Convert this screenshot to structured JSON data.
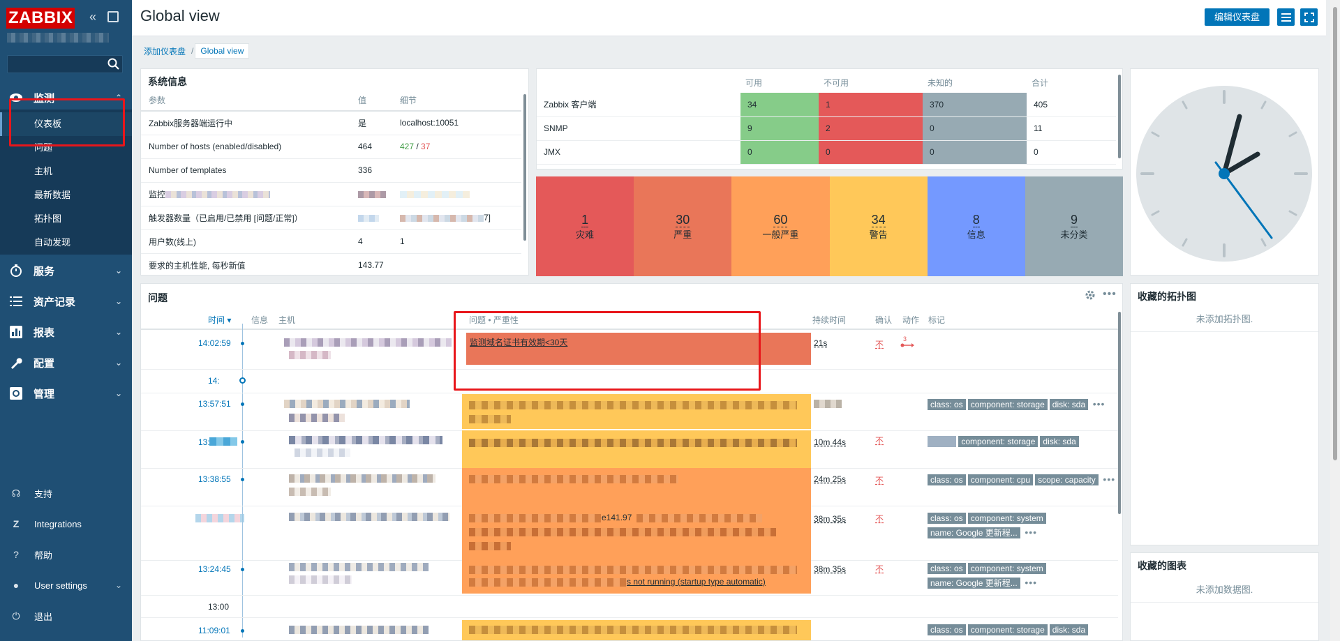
{
  "brand": {
    "logo": "ZABBIX"
  },
  "sidebar": {
    "monitoring": "监测",
    "sub_items": [
      "仪表板",
      "问题",
      "主机",
      "最新数据",
      "拓扑图",
      "自动发现"
    ],
    "sections": [
      "服务",
      "资产记录",
      "报表",
      "配置",
      "管理"
    ],
    "bottom": [
      "支持",
      "Integrations",
      "帮助",
      "User settings",
      "退出"
    ]
  },
  "header": {
    "title": "Global view",
    "edit_button": "编辑仪表盘"
  },
  "breadcrumb": [
    "添加仪表盘",
    "Global view"
  ],
  "system_info": {
    "title": "系统信息",
    "columns": [
      "参数",
      "值",
      "细节"
    ],
    "rows": [
      {
        "param": "Zabbix服务器端运行中",
        "value": "是",
        "detail": "localhost:10051"
      },
      {
        "param": "Number of hosts (enabled/disabled)",
        "value": "464",
        "detail_enabled": "427",
        "detail_sep": " / ",
        "detail_disabled": "37"
      },
      {
        "param": "Number of templates",
        "value": "336",
        "detail": ""
      },
      {
        "param": "监控",
        "value": "",
        "detail": ""
      },
      {
        "param": "触发器数量（已启用/已禁用 [问题/正常]）",
        "value": "",
        "detail": "7]"
      },
      {
        "param": "用户数(线上)",
        "value": "4",
        "detail": "1"
      },
      {
        "param": "要求的主机性能, 每秒新值",
        "value": "143.77",
        "detail": ""
      }
    ]
  },
  "host_availability": {
    "columns": [
      "可用",
      "不可用",
      "未知的",
      "合计"
    ],
    "rows": [
      {
        "name": "Zabbix 客户端",
        "available": "34",
        "unavailable": "1",
        "unknown": "370",
        "total": "405"
      },
      {
        "name": "SNMP",
        "available": "9",
        "unavailable": "2",
        "unknown": "0",
        "total": "11"
      },
      {
        "name": "JMX",
        "available": "0",
        "unavailable": "0",
        "unknown": "0",
        "total": "0"
      }
    ]
  },
  "severity": [
    {
      "count": "1",
      "label": "灾难",
      "color": "#e45959"
    },
    {
      "count": "30",
      "label": "严重",
      "color": "#e97659"
    },
    {
      "count": "60",
      "label": "一般严重",
      "color": "#ffa059"
    },
    {
      "count": "34",
      "label": "警告",
      "color": "#ffc859"
    },
    {
      "count": "8",
      "label": "信息",
      "color": "#7499ff"
    },
    {
      "count": "9",
      "label": "未分类",
      "color": "#97aab3"
    }
  ],
  "problems": {
    "title": "问题",
    "columns": [
      "时间",
      "信息",
      "主机",
      "问题 • 严重性",
      "持续时间",
      "确认",
      "动作",
      "标记"
    ],
    "rows": [
      {
        "time": "14:02:59",
        "problem": "监测域名证书有效期<30天",
        "duration": "21s",
        "ack": "不",
        "action": "3"
      },
      {
        "time": "14:",
        "problem": "",
        "duration": "",
        "ack": ""
      },
      {
        "time": "13:57:51",
        "problem": "",
        "duration": "",
        "ack": "",
        "tags": [
          "class: os",
          "component: storage",
          "disk: sda"
        ]
      },
      {
        "time": "13:",
        "problem": "",
        "duration": "10m 44s",
        "ack": "不",
        "tags": [
          "component: storage",
          "disk: sda"
        ]
      },
      {
        "time": "13:38:55",
        "problem": "",
        "duration": "24m 25s",
        "ack": "不",
        "tags": [
          "class: os",
          "component: cpu",
          "scope: capacity"
        ]
      },
      {
        "time": "",
        "problem": "e141.97",
        "duration": "38m 35s",
        "ack": "不",
        "tags": [
          "class: os",
          "component: system",
          "name: Google 更新程..."
        ]
      },
      {
        "time": "13:24:45",
        "problem": "s not running (startup type automatic)",
        "duration": "38m 35s",
        "ack": "不",
        "tags": [
          "class: os",
          "component: system",
          "name: Google 更新程..."
        ]
      },
      {
        "time": "13:00",
        "problem": "",
        "duration": "",
        "ack": ""
      },
      {
        "time": "11:09:01",
        "problem": "",
        "duration": "",
        "ack": "",
        "tags": [
          "class: os",
          "component: storage",
          "disk: sda"
        ]
      }
    ]
  },
  "fav_maps": {
    "title": "收藏的拓扑图",
    "empty": "未添加拓扑图."
  },
  "fav_graphs": {
    "title": "收藏的图表",
    "empty": "未添加数据图."
  },
  "colors": {
    "sidebar": "#1f4f74",
    "accent": "#0275b8",
    "highlight": "#e8161b"
  }
}
